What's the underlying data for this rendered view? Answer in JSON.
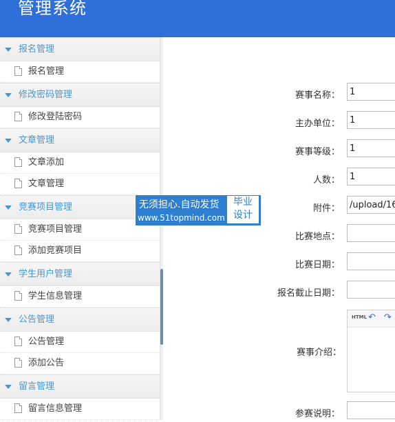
{
  "header": {
    "title": "管理系统"
  },
  "sidebar": {
    "sections": [
      {
        "label": "报名管理",
        "items": [
          "报名管理"
        ]
      },
      {
        "label": "修改密码管理",
        "items": [
          "修改登陆密码"
        ]
      },
      {
        "label": "文章管理",
        "items": [
          "文章添加",
          "文章管理"
        ]
      },
      {
        "label": "竞赛项目管理",
        "items": [
          "竞赛项目管理",
          "添加竞赛项目"
        ]
      },
      {
        "label": "学生用户管理",
        "items": [
          "学生信息管理"
        ]
      },
      {
        "label": "公告管理",
        "items": [
          "公告管理",
          "添加公告"
        ]
      },
      {
        "label": "留言管理",
        "items": [
          "留言信息管理"
        ]
      }
    ]
  },
  "watermark": {
    "line1": "无须担心.自动发货",
    "line2": "www.51topmind.com",
    "badge_line1": "毕业",
    "badge_line2": "设计"
  },
  "form": {
    "fields": [
      {
        "label": "赛事名称：",
        "value": "1"
      },
      {
        "label": "主办单位：",
        "value": "1"
      },
      {
        "label": "赛事等级：",
        "value": "1"
      },
      {
        "label": "人数：",
        "value": "1"
      },
      {
        "label": "附件：",
        "value": "/upload/16"
      },
      {
        "label": "比赛地点：",
        "value": ""
      },
      {
        "label": "比赛日期：",
        "value": ""
      },
      {
        "label": "报名截止日期：",
        "value": ""
      }
    ],
    "intro_label": "赛事介绍：",
    "editor_html_button": "HTML",
    "notes_label": "参赛说明："
  }
}
